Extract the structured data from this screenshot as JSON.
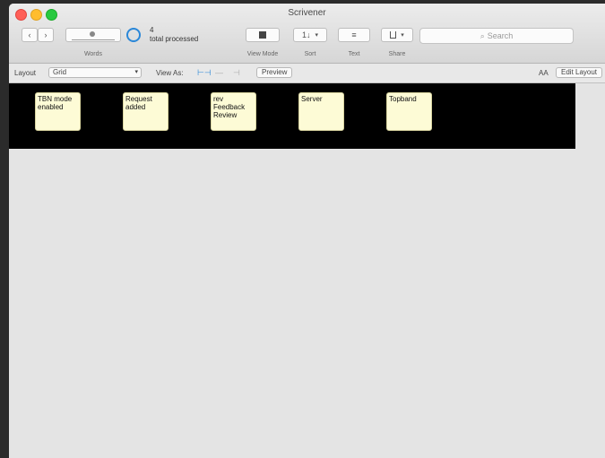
{
  "window": {
    "title": "Scrivener"
  },
  "toolbar": {
    "nav": {
      "back": "‹",
      "forward": "›"
    },
    "words": {
      "label": "Words"
    },
    "status": {
      "count": "4",
      "text": "total processed"
    },
    "view": {
      "label": "View Mode"
    },
    "sort": {
      "label": "Sort",
      "value": "1↓"
    },
    "text": {
      "label": "Text",
      "value": "≡"
    },
    "share": {
      "label": "Share"
    },
    "search": {
      "placeholder": "Search",
      "icon": "search-icon"
    }
  },
  "layoutbar": {
    "layout_label": "Layout",
    "layout_value": "Grid",
    "view_as_label": "View As:",
    "preview_label": "Preview",
    "aa_label": "AA",
    "edit_layout_label": "Edit Layout"
  },
  "cards": [
    {
      "text": "TBN mode enabled"
    },
    {
      "text": "Request added"
    },
    {
      "text": "rev Feedback Review"
    },
    {
      "text": "Server"
    },
    {
      "text": "Topband"
    }
  ],
  "colors": {
    "accent": "#2a87d8",
    "card_bg": "#fdfbd6",
    "canvas_bg": "#000000"
  }
}
